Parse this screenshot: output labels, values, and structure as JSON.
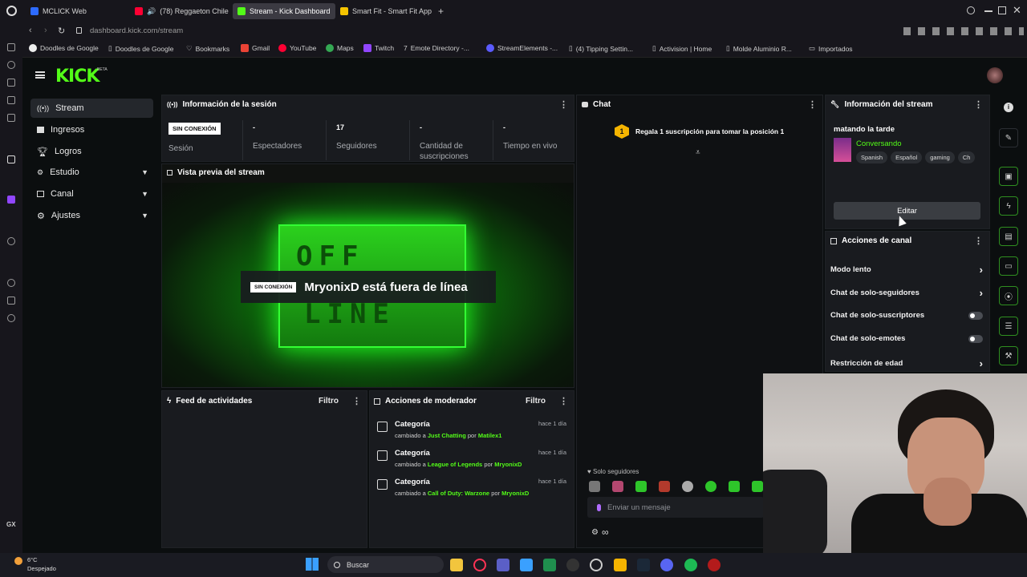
{
  "browser": {
    "tabs": [
      {
        "label": "MCLICK Web",
        "color": "#2d6bff"
      },
      {
        "label": "(78) Reggaeton Chile",
        "color": "#ff0033"
      },
      {
        "label": "Stream - Kick Dashboard",
        "color": "#53fc18"
      },
      {
        "label": "Smart Fit - Smart Fit App",
        "color": "#f5c400"
      }
    ],
    "new_tab": "+",
    "url_domain": "dashboard.kick.com",
    "url_path": "/stream",
    "bookmarks": [
      "Doodles de Google",
      "Doodles de Google",
      "Bookmarks",
      "Gmail",
      "YouTube",
      "Maps",
      "Twitch",
      "Emote Directory -...",
      "StreamElements -...",
      "(4) Tipping Settin...",
      "Activision | Home",
      "Molde Aluminio R...",
      "Importados"
    ],
    "rail_label": "GX"
  },
  "kick": {
    "logo": "KICK",
    "logo_sup": "BETA",
    "nav": [
      {
        "label": "Stream",
        "icon": "stream-icon",
        "selected": true
      },
      {
        "label": "Ingresos",
        "icon": "revenue-icon"
      },
      {
        "label": "Logros",
        "icon": "trophy-icon"
      },
      {
        "label": "Estudio",
        "icon": "studio-icon",
        "expand": true
      },
      {
        "label": "Canal",
        "icon": "channel-icon",
        "expand": true
      },
      {
        "label": "Ajustes",
        "icon": "gear-icon",
        "expand": true
      }
    ]
  },
  "session": {
    "title": "Información de la sesión",
    "status_badge": "SIN CONEXIÓN",
    "status_label": "Sesión",
    "stats": [
      {
        "value": "-",
        "label": "Espectadores"
      },
      {
        "value": "17",
        "label": "Seguidores"
      },
      {
        "value": "-",
        "label": "Cantidad de suscripciones"
      },
      {
        "value": "-",
        "label": "Tiempo en vivo"
      }
    ]
  },
  "preview": {
    "title": "Vista previa del stream",
    "badge": "SIN CONEXIÓN",
    "message": "MryonixD está fuera de línea",
    "sign_top": "OFF",
    "sign_bottom": "LINE"
  },
  "chat": {
    "title": "Chat",
    "promo_rank": "1",
    "promo": "Regala 1 suscripción para tomar la posición 1",
    "mode": "Solo seguidores",
    "placeholder": "Enviar un mensaje"
  },
  "stream_info": {
    "title": "Información del stream",
    "stream_title": "matando la tarde",
    "category": "Conversando",
    "tags": [
      "Spanish",
      "Español",
      "gaming",
      "Ch"
    ],
    "edit": "Editar"
  },
  "channel_actions": {
    "title": "Acciones de canal",
    "items": [
      {
        "label": "Modo lento",
        "kind": "arrow"
      },
      {
        "label": "Chat de solo-seguidores",
        "kind": "arrow"
      },
      {
        "label": "Chat de solo-suscriptores",
        "kind": "toggle"
      },
      {
        "label": "Chat de solo-emotes",
        "kind": "toggle"
      },
      {
        "label": "Restricción de edad",
        "kind": "arrow"
      }
    ]
  },
  "activity": {
    "title": "Feed de actividades",
    "filter": "Filtro"
  },
  "mod_actions": {
    "title": "Acciones de moderador",
    "filter": "Filtro",
    "items": [
      {
        "title": "Categoría",
        "pre": "cambiado a",
        "target": "Just Chatting",
        "by": "por",
        "user": "Matilex1",
        "time": "hace 1 día"
      },
      {
        "title": "Categoría",
        "pre": "cambiado a",
        "target": "League of Legends",
        "by": "por",
        "user": "MryonixD",
        "time": "hace 1 día"
      },
      {
        "title": "Categoría",
        "pre": "cambiado a",
        "target": "Call of Duty: Warzone",
        "by": "por",
        "user": "MryonixD",
        "time": "hace 1 día"
      }
    ]
  },
  "taskbar": {
    "weather_temp": "6°C",
    "weather_desc": "Despejado",
    "search": "Buscar"
  },
  "colors": {
    "accent": "#53fc18",
    "panel": "#191b1f",
    "bg": "#0b0e0f"
  }
}
